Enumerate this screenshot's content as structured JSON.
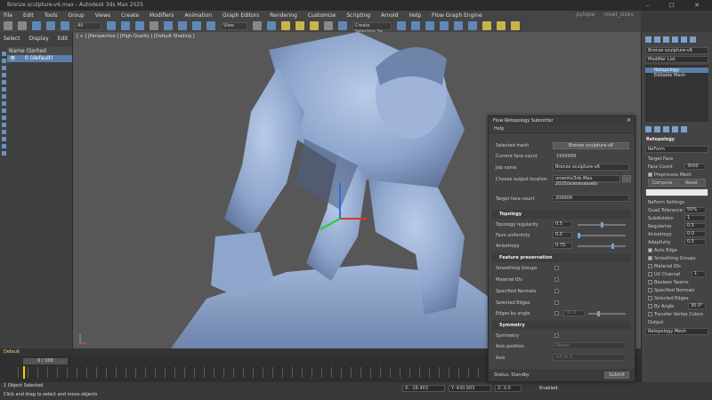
{
  "window": {
    "title": "Bronze sculpture-v6.max - Autodesk 3ds Max 2025"
  },
  "menu": {
    "items": [
      "File",
      "Edit",
      "Tools",
      "Group",
      "Views",
      "Create",
      "Modifiers",
      "Animation",
      "Graph Editors",
      "Rendering",
      "Customize",
      "Scripting",
      "Arnold",
      "Help",
      "Flow Graph Engine"
    ],
    "right": [
      "pylopw",
      "reset_sizev"
    ]
  },
  "toolbar": {
    "filter": "All",
    "view": "View",
    "selection_set": "Create Selection Se"
  },
  "scene_explorer": {
    "tabs": [
      "Select",
      "Display",
      "Edit"
    ],
    "header": "Name (Sorted Ascending)",
    "row": "0 (default)"
  },
  "viewport": {
    "label": "[ + ] [Perspective ] [High Quality ] [Default Shading ]"
  },
  "timeline": {
    "layer": "Default",
    "frame": "0 / 100"
  },
  "status": {
    "selection": "1 Object Selected",
    "hint": "Click and drag to select and move objects",
    "x": "X: -16.403",
    "y": "Y: 430.903",
    "z": "Z: 0.0",
    "enabled": "Enabled:"
  },
  "command_panel": {
    "object_name": "Bronze sculpture-v6",
    "modifier_list": "Modifier List",
    "stack": [
      "Retopology",
      "Editable Mesh"
    ],
    "section": "Retopology",
    "retopo_method": "ReForm",
    "target_face": "Target Face",
    "face_count_label": "Face Count",
    "face_count": "3000",
    "preprocess_mesh": "Preprocess Mesh",
    "compute": "Compute",
    "reset": "Reset",
    "reform_settings": "ReForm Settings",
    "quad_tolerance_label": "Quad Tolerance",
    "quad_tolerance": "50%",
    "subdivision_label": "Subdivision",
    "subdivision": "1",
    "regularize_label": "Regularize",
    "regularize": "0.5",
    "anisotropy_label": "Anisotropy",
    "anisotropy": "0.0",
    "adaptivity_label": "Adaptivity",
    "adaptivity": "0.5",
    "checks": [
      "Auto Edge",
      "Smoothing Groups",
      "Material IDs",
      "UV Channel",
      "Boolean Seams",
      "Specified Normals",
      "Selected Edges",
      "By Angle",
      "Transfer Vertex Colors"
    ],
    "uv_channel": "1",
    "by_angle": "30.0°",
    "output_label": "Output",
    "output": "Retopology Mesh"
  },
  "dialog": {
    "title": "Flow Retopology Submitter",
    "menu": "Help",
    "selected_mesh_label": "Selected mesh",
    "selected_mesh": "Bronze sculpture-v6",
    "current_face_count_label": "Current face count",
    "current_face_count": "1999999",
    "job_name_label": "Job name",
    "job_name": "Bronze sculpture-v6",
    "output_location_label": "Choose output location",
    "output_location": "uments/3ds Max 2025/scenesassets",
    "browse": "...",
    "target_face_count_label": "Target face count",
    "target_face_count": "200000",
    "topology_title": "Topology",
    "topology_regularity_label": "Topology regularity",
    "topology_regularity": "0.5",
    "topology_regularity_slider": 0.5,
    "face_uniformity_label": "Face uniformity",
    "face_uniformity": "0.0",
    "face_uniformity_slider": 0.0,
    "anisotropy_label": "Anisotropy",
    "anisotropy": "0.75",
    "anisotropy_slider": 0.75,
    "feature_title": "Feature preservation",
    "features": [
      "Smoothing Groups",
      "Material IDs",
      "Specified Normals",
      "Selected Edges"
    ],
    "edges_by_angle_label": "Edges by angle",
    "edges_by_angle": "30.0",
    "symmetry_title": "Symmetry",
    "symmetry_label": "Symmetry",
    "axis_position_label": "Axis position",
    "axis_position": "Object",
    "axis_label": "Axis",
    "axis": "+X to X",
    "status": "Status: Standby",
    "submit": "Submit"
  }
}
